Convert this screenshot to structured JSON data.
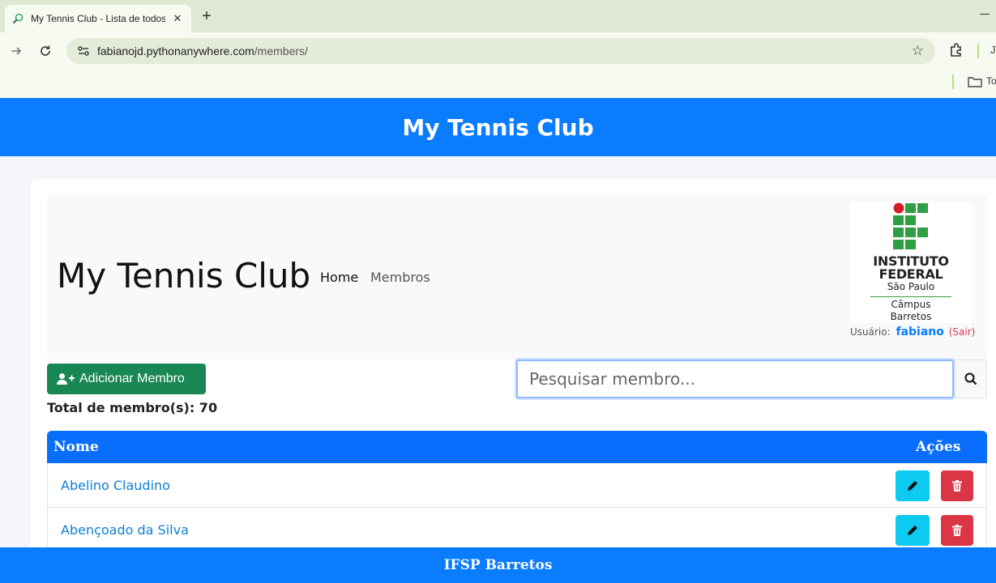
{
  "browser": {
    "tab_title": "My Tennis Club - Lista de todos",
    "url_host": "fabianojd.pythonanywhere.com",
    "url_path": "/members/",
    "profile_letter": "J",
    "bookmark_label": "To"
  },
  "header": {
    "title": "My Tennis Club"
  },
  "navbar": {
    "brand": "My Tennis Club",
    "links": [
      "Home",
      "Membros"
    ]
  },
  "logo": {
    "line1": "INSTITUTO",
    "line2": "FEDERAL",
    "line3": "São Paulo",
    "line4": "Câmpus",
    "line5": "Barretos"
  },
  "user": {
    "label": "Usuário:",
    "name": "fabiano",
    "logout": "(Sair)"
  },
  "actions": {
    "add_label": "Adicionar Membro"
  },
  "total_text": "Total de membro(s): 70",
  "search": {
    "placeholder": "Pesquisar membro..."
  },
  "table": {
    "headers": [
      "Nome",
      "Ações"
    ],
    "rows": [
      "Abelino Claudino",
      "Abençoado da Silva"
    ]
  },
  "footer": {
    "text": "IFSP Barretos"
  },
  "colors": {
    "primary": "#0a7cff",
    "success": "#198754",
    "info": "#0dcaf0",
    "danger": "#dc3545"
  }
}
